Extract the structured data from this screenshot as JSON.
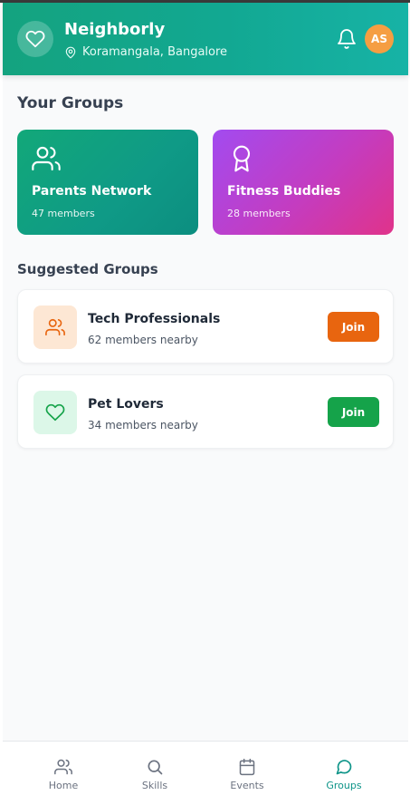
{
  "header": {
    "app_name": "Neighborly",
    "location": "Koramangala, Bangalore",
    "avatar_initials": "AS"
  },
  "your_groups": {
    "title": "Your Groups",
    "items": [
      {
        "name": "Parents Network",
        "members": "47 members",
        "icon": "users-icon",
        "gradient": [
          "#12a879",
          "#0c8e80"
        ]
      },
      {
        "name": "Fitness Buddies",
        "members": "28 members",
        "icon": "award-icon",
        "gradient": [
          "#a24bf0",
          "#e0338a"
        ]
      }
    ]
  },
  "suggested_groups": {
    "title": "Suggested Groups",
    "items": [
      {
        "name": "Tech Professionals",
        "meta": "62 members nearby",
        "join_label": "Join",
        "icon": "users-icon",
        "accent": "#e8650f"
      },
      {
        "name": "Pet Lovers",
        "meta": "34 members nearby",
        "join_label": "Join",
        "icon": "heart-icon",
        "accent": "#15a34a"
      }
    ]
  },
  "bottom_nav": {
    "items": [
      {
        "label": "Home",
        "icon": "users-icon"
      },
      {
        "label": "Skills",
        "icon": "search-icon"
      },
      {
        "label": "Events",
        "icon": "calendar-icon"
      },
      {
        "label": "Groups",
        "icon": "chat-icon",
        "active": true
      }
    ]
  },
  "colors": {
    "brand": "#14a37f",
    "active_nav": "#0d9488"
  }
}
